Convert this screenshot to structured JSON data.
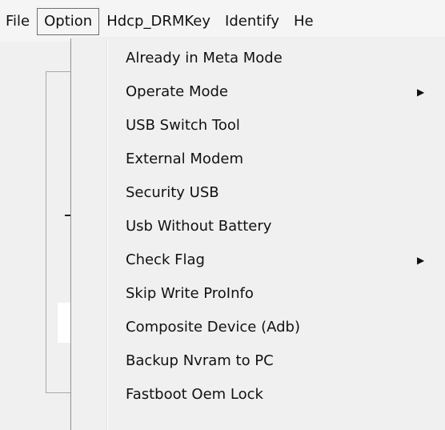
{
  "menubar": {
    "items": [
      {
        "label": "File"
      },
      {
        "label": "Option"
      },
      {
        "label": "Hdcp_DRMKey"
      },
      {
        "label": "Identify"
      },
      {
        "label": "He"
      }
    ],
    "active_index": 1
  },
  "option_menu": {
    "items": [
      {
        "label": "Already in Meta Mode",
        "has_submenu": false
      },
      {
        "label": "Operate Mode",
        "has_submenu": true,
        "submenu_icon": "submenu-arrow-icon"
      },
      {
        "label": "USB Switch Tool",
        "has_submenu": false
      },
      {
        "label": "External Modem",
        "has_submenu": false
      },
      {
        "label": "Security USB",
        "has_submenu": false
      },
      {
        "label": "Usb Without Battery",
        "has_submenu": false
      },
      {
        "label": "Check Flag",
        "has_submenu": true,
        "submenu_icon": "submenu-arrow-icon"
      },
      {
        "label": "Skip Write ProInfo",
        "has_submenu": false
      },
      {
        "label": "Composite Device (Adb)",
        "has_submenu": false
      },
      {
        "label": "Backup Nvram to PC",
        "has_submenu": false
      },
      {
        "label": "Fastboot Oem Lock",
        "has_submenu": false
      }
    ]
  },
  "colors": {
    "menu_background": "#f0f0f0",
    "menubar_background": "#f5f5f5",
    "active_border": "#6f6f6f",
    "text": "#111111"
  }
}
